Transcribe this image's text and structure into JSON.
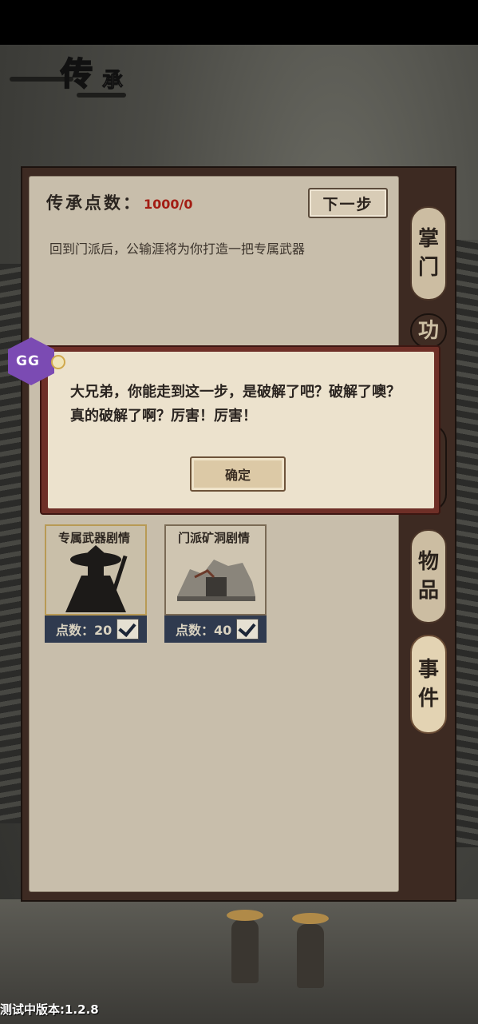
{
  "header": {
    "title_big": "传",
    "title_small": "承"
  },
  "panel": {
    "points_label": "传承点数：",
    "points_value": "1000/0",
    "next_button": "下一步",
    "description": "回到门派后，公输涯将为你打造一把专属武器"
  },
  "side_tabs": [
    {
      "label": "掌门",
      "state": "normal"
    },
    {
      "label": "功",
      "state": "dark"
    },
    {
      "label": "",
      "state": "dark"
    },
    {
      "label": "物品",
      "state": "normal"
    },
    {
      "label": "事件",
      "state": "active"
    }
  ],
  "cards": [
    {
      "title": "专属武器剧情",
      "points": "点数：20",
      "checked": true,
      "selected": true
    },
    {
      "title": "门派矿洞剧情",
      "points": "点数：40",
      "checked": true,
      "selected": false
    }
  ],
  "dialog": {
    "message": "大兄弟，你能走到这一步，是破解了吧？破解了噢？真的破解了啊？厉害！厉害！",
    "confirm_button": "确定"
  },
  "overlay_badge": {
    "text": "GG"
  },
  "footer": {
    "version": "测试中版本:1.2.8"
  },
  "colors": {
    "accent_red": "#a31d14",
    "dialog_border": "#6e2f27",
    "card_footer": "#2f3a4f",
    "gg_purple": "#7b4bb3"
  }
}
